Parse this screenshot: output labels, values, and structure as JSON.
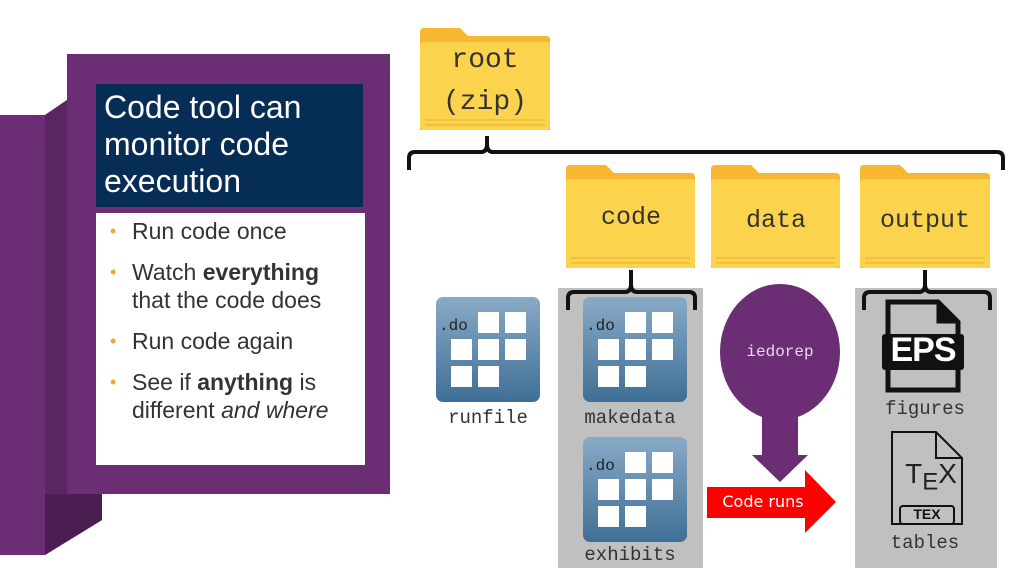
{
  "panel": {
    "title": "Code tool can monitor code execution",
    "bullets": [
      {
        "parts": [
          {
            "t": "Run code once",
            "s": "normal"
          }
        ]
      },
      {
        "parts": [
          {
            "t": "Watch ",
            "s": "normal"
          },
          {
            "t": "everything",
            "s": "bold"
          },
          {
            "t": " that the code does",
            "s": "normal"
          }
        ]
      },
      {
        "parts": [
          {
            "t": "Run code again",
            "s": "normal"
          }
        ]
      },
      {
        "parts": [
          {
            "t": "See if ",
            "s": "normal"
          },
          {
            "t": "anything",
            "s": "bold"
          },
          {
            "t": " is different ",
            "s": "normal"
          },
          {
            "t": "and where",
            "s": "italic"
          }
        ]
      }
    ]
  },
  "root": {
    "line1": "root",
    "line2": "(zip)"
  },
  "folders": {
    "code": "code",
    "data": "data",
    "output": "output"
  },
  "files": {
    "ext": ".do",
    "runfile": "runfile",
    "makedata": "makedata",
    "exhibits": "exhibits",
    "figures": "figures",
    "tables": "tables",
    "eps": "EPS",
    "tex_badge": "TEX",
    "tex_logo": "TEX"
  },
  "tool": {
    "name": "iedorep",
    "arrow_label": "Code runs"
  },
  "colors": {
    "purple": "#6b2d73",
    "navy": "#062d55",
    "folder": "#fcd34d",
    "red": "#ff0000",
    "gray": "#c0c0c0",
    "bullet": "#f0a830"
  }
}
